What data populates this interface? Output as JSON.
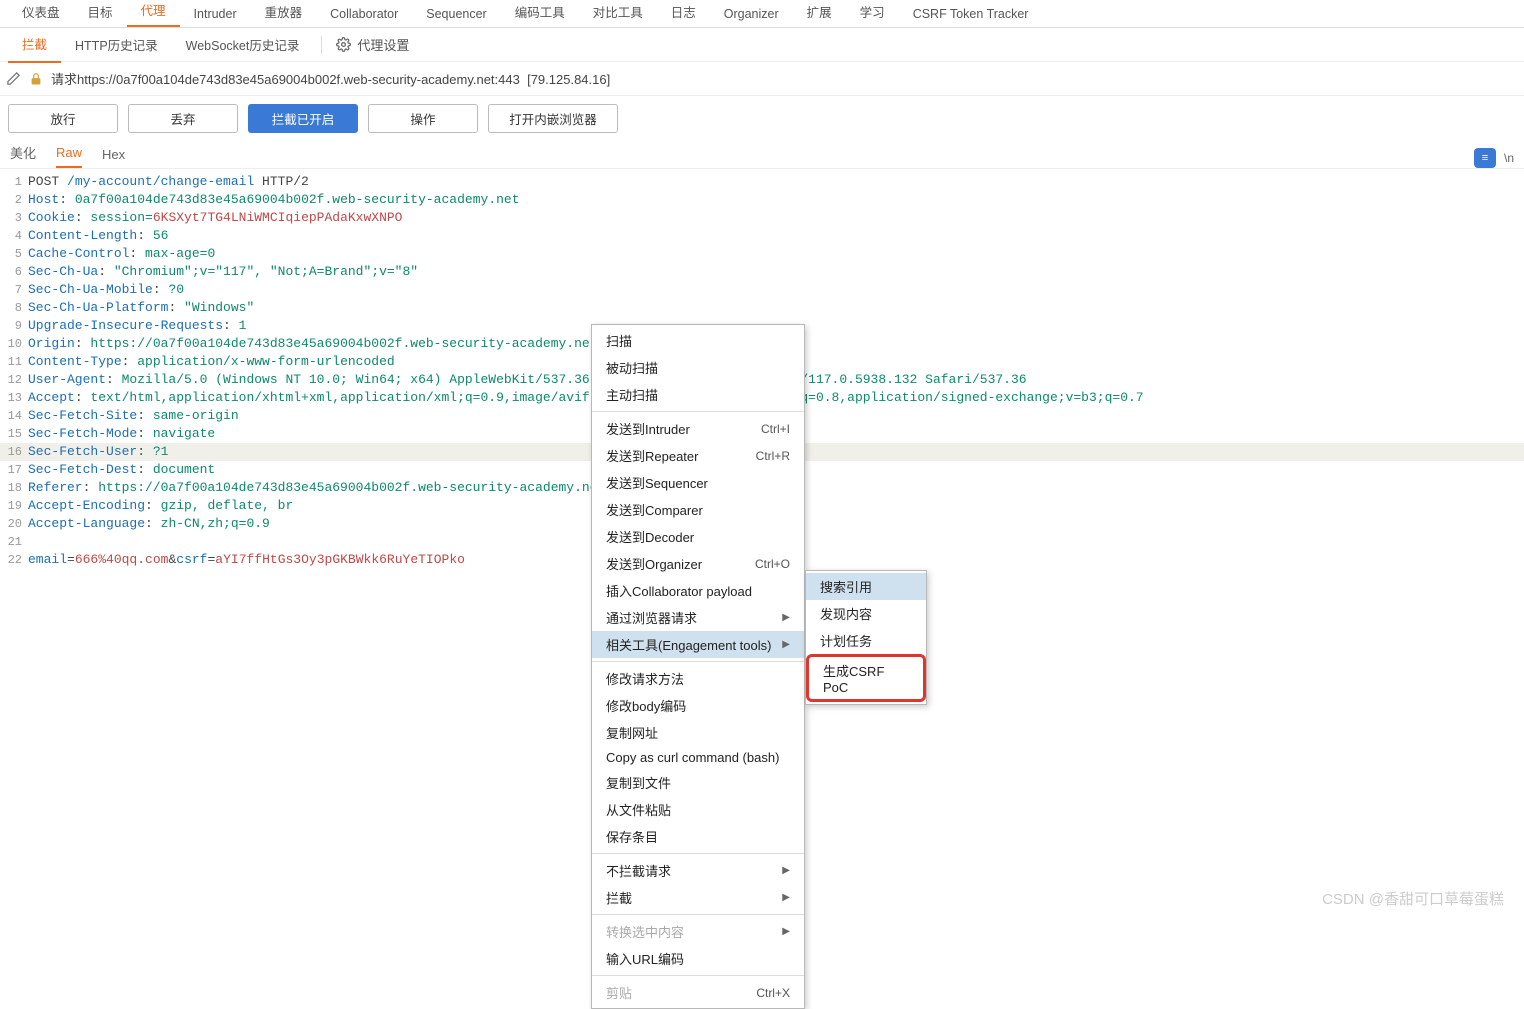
{
  "topTabs": [
    "仪表盘",
    "目标",
    "代理",
    "Intruder",
    "重放器",
    "Collaborator",
    "Sequencer",
    "编码工具",
    "对比工具",
    "日志",
    "Organizer",
    "扩展",
    "学习",
    "CSRF Token Tracker"
  ],
  "activeTopTab": 2,
  "subTabs": [
    "拦截",
    "HTTP历史记录",
    "WebSocket历史记录"
  ],
  "activeSubTab": 0,
  "proxySettings": "代理设置",
  "request": {
    "label": "请求",
    "url": "https://0a7f00a104de743d83e45a69004b002f.web-security-academy.net:443",
    "ip": "[79.125.84.16]"
  },
  "buttons": {
    "forward": "放行",
    "drop": "丢弃",
    "intercept": "拦截已开启",
    "action": "操作",
    "browser": "打开内嵌浏览器"
  },
  "viewTabs": [
    "美化",
    "Raw",
    "Hex"
  ],
  "activeViewTab": 1,
  "rightBadge": "≡",
  "rightNl": "\\n",
  "raw": {
    "lines": [
      {
        "n": 1,
        "method": "POST",
        "path": "/my-account/change-email",
        "proto": "HTTP/2"
      },
      {
        "n": 2,
        "k": "Host",
        "v": "0a7f00a104de743d83e45a69004b002f.web-security-academy.net"
      },
      {
        "n": 3,
        "k": "Cookie",
        "v": "session=",
        "cookie": "6KSXyt7TG4LNiWMCIqiepPAdaKxwXNPO"
      },
      {
        "n": 4,
        "k": "Content-Length",
        "v": "56"
      },
      {
        "n": 5,
        "k": "Cache-Control",
        "v": "max-age=0"
      },
      {
        "n": 6,
        "k": "Sec-Ch-Ua",
        "v": "\"Chromium\";v=\"117\", \"Not;A=Brand\";v=\"8\""
      },
      {
        "n": 7,
        "k": "Sec-Ch-Ua-Mobile",
        "v": "?0"
      },
      {
        "n": 8,
        "k": "Sec-Ch-Ua-Platform",
        "v": "\"Windows\""
      },
      {
        "n": 9,
        "k": "Upgrade-Insecure-Requests",
        "v": "1"
      },
      {
        "n": 10,
        "k": "Origin",
        "v": "https://0a7f00a104de743d83e45a69004b002f.web-security-academy.net"
      },
      {
        "n": 11,
        "k": "Content-Type",
        "v": "application/x-www-form-urlencoded"
      },
      {
        "n": 12,
        "k": "User-Agent",
        "v": "Mozilla/5.0 (Windows NT 10.0; Win64; x64) AppleWebKit/537.36 (KHTML, like Gecko) Chrome/117.0.5938.132 Safari/537.36"
      },
      {
        "n": 13,
        "k": "Accept",
        "v": "text/html,application/xhtml+xml,application/xml;q=0.9,image/avif,image/webp,image/apng,*/*;q=0.8,application/signed-exchange;v=b3;q=0.7"
      },
      {
        "n": 14,
        "k": "Sec-Fetch-Site",
        "v": "same-origin"
      },
      {
        "n": 15,
        "k": "Sec-Fetch-Mode",
        "v": "navigate"
      },
      {
        "n": 16,
        "k": "Sec-Fetch-User",
        "v": "?1"
      },
      {
        "n": 17,
        "k": "Sec-Fetch-Dest",
        "v": "document"
      },
      {
        "n": 18,
        "k": "Referer",
        "v": "https://0a7f00a104de743d83e45a69004b002f.web-security-academy.net/my-"
      },
      {
        "n": 19,
        "k": "Accept-Encoding",
        "v": "gzip, deflate, br"
      },
      {
        "n": 20,
        "k": "Accept-Language",
        "v": "zh-CN,zh;q=0.9"
      },
      {
        "n": 21,
        "blank": true
      },
      {
        "n": 22,
        "body": true,
        "p1": "email",
        "v1": "666%40qq.com",
        "amp": "&",
        "p2": "csrf",
        "v2": "aYI7ffHtGs3Oy3pGKBWkk6RuYeTIOPko"
      }
    ]
  },
  "menu": {
    "items": [
      {
        "label": "扫描"
      },
      {
        "label": "被动扫描"
      },
      {
        "label": "主动扫描"
      },
      {
        "sep": true
      },
      {
        "label": "发送到Intruder",
        "shortcut": "Ctrl+I"
      },
      {
        "label": "发送到Repeater",
        "shortcut": "Ctrl+R"
      },
      {
        "label": "发送到Sequencer"
      },
      {
        "label": "发送到Comparer"
      },
      {
        "label": "发送到Decoder"
      },
      {
        "label": "发送到Organizer",
        "shortcut": "Ctrl+O"
      },
      {
        "label": "插入Collaborator payload"
      },
      {
        "label": "通过浏览器请求",
        "sub": true
      },
      {
        "label": "相关工具(Engagement tools)",
        "sub": true,
        "highlight": true
      },
      {
        "sep": true
      },
      {
        "label": "修改请求方法"
      },
      {
        "label": "修改body编码"
      },
      {
        "label": "复制网址"
      },
      {
        "label": "Copy as curl command (bash)"
      },
      {
        "label": "复制到文件"
      },
      {
        "label": "从文件粘贴"
      },
      {
        "label": "保存条目"
      },
      {
        "sep": true
      },
      {
        "label": "不拦截请求",
        "sub": true
      },
      {
        "label": "拦截",
        "sub": true
      },
      {
        "sep": true
      },
      {
        "label": "转换选中内容",
        "sub": true,
        "disabled": true
      },
      {
        "label": "输入URL编码"
      },
      {
        "sep": true
      },
      {
        "label": "剪贴",
        "shortcut": "Ctrl+X",
        "disabled": true
      }
    ],
    "subItems": [
      {
        "label": "搜索引用",
        "highlight": true
      },
      {
        "label": "发现内容"
      },
      {
        "label": "计划任务"
      },
      {
        "label": "生成CSRF PoC",
        "red": true
      }
    ]
  },
  "watermark": "CSDN @香甜可口草莓蛋糕"
}
